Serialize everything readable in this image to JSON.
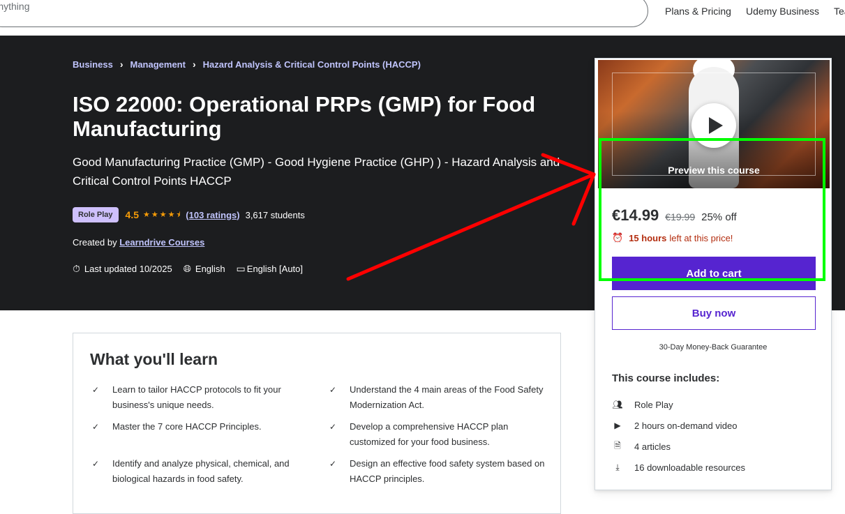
{
  "search": {
    "placeholder": "r anything"
  },
  "nav": {
    "plans": "Plans & Pricing",
    "business": "Udemy Business",
    "teach": "Tea"
  },
  "breadcrumb": [
    "Business",
    "Management",
    "Hazard Analysis & Critical Control Points (HACCP)"
  ],
  "course": {
    "title": "ISO 22000: Operational PRPs (GMP) for Food Manufacturing",
    "subtitle": "Good Manufacturing Practice (GMP) - Good Hygiene Practice (GHP) ) - Hazard Analysis and Critical Control Points HACCP",
    "badge": "Role Play",
    "rating": "4.5",
    "ratings_count": "(103 ratings)",
    "students": "3,617 students",
    "created_by_label": "Created by",
    "author": "Learndrive Courses",
    "last_updated": "Last updated 10/2025",
    "language": "English",
    "captions": "English [Auto]"
  },
  "sidebar": {
    "preview_label": "Preview this course",
    "price": "€14.99",
    "original_price": "€19.99",
    "discount": "25% off",
    "timer_bold": "15 hours",
    "timer_rest": "left at this price!",
    "add_to_cart": "Add to cart",
    "buy_now": "Buy now",
    "guarantee": "30-Day Money-Back Guarantee",
    "includes_title": "This course includes:",
    "includes": [
      {
        "icon": "role-play-icon",
        "label": "Role Play"
      },
      {
        "icon": "video-icon",
        "label": "2 hours on-demand video"
      },
      {
        "icon": "article-icon",
        "label": "4 articles"
      },
      {
        "icon": "download-icon",
        "label": "16 downloadable resources"
      }
    ]
  },
  "learn": {
    "title": "What you'll learn",
    "items": [
      "Learn to tailor HACCP protocols to fit your business's unique needs.",
      "Understand the 4 main areas of the Food Safety Modernization Act.",
      "Master the 7 core HACCP Principles.",
      "Develop a comprehensive HACCP plan customized for your food business.",
      "Identify and analyze physical, chemical, and biological hazards in food safety.",
      "Design an effective food safety system based on HACCP principles."
    ]
  },
  "annotation": {
    "arrow_color": "#ff0000",
    "box_color": "#00ff00"
  }
}
